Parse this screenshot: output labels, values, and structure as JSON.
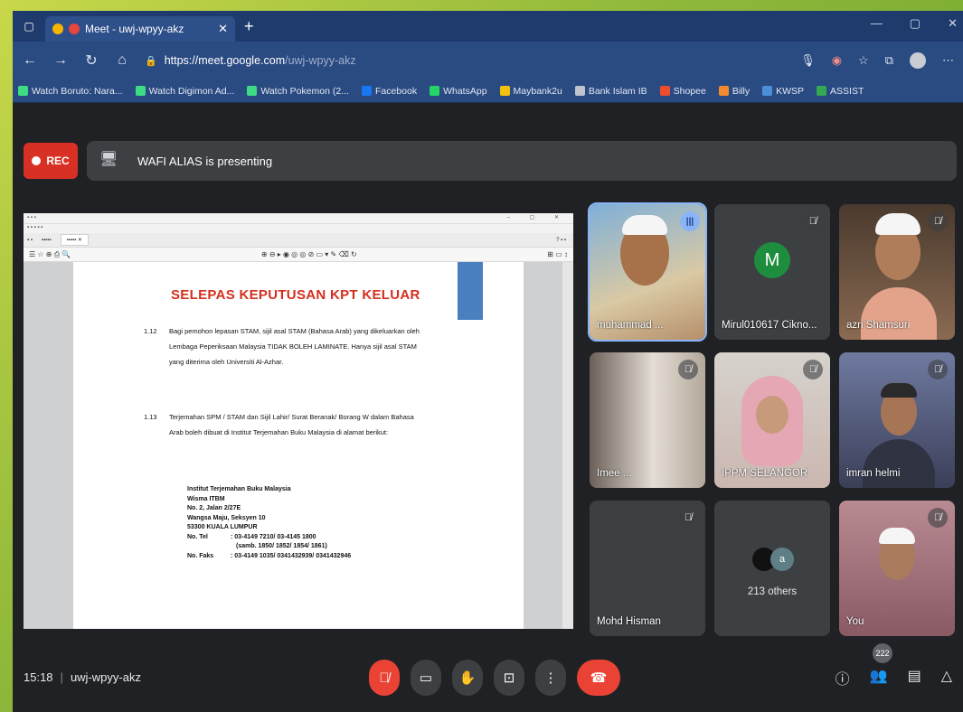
{
  "browser": {
    "tab_title": "Meet - uwj-wpyy-akz",
    "url_host": "https://meet.google.com",
    "url_path": "/uwj-wpyy-akz",
    "bookmarks": [
      {
        "label": "Watch Boruto: Nara...",
        "color": "#3ddc84"
      },
      {
        "label": "Watch Digimon Ad...",
        "color": "#3ddc84"
      },
      {
        "label": "Watch Pokemon (2...",
        "color": "#3ddc84"
      },
      {
        "label": "Facebook",
        "color": "#1877f2"
      },
      {
        "label": "WhatsApp",
        "color": "#25d366"
      },
      {
        "label": "Maybank2u",
        "color": "#f4c20d"
      },
      {
        "label": "Bank Islam IB",
        "color": "#c0c4cc"
      },
      {
        "label": "Shopee",
        "color": "#ee4d2d"
      },
      {
        "label": "Billy",
        "color": "#f28b30"
      },
      {
        "label": "KWSP",
        "color": "#4a90d9"
      },
      {
        "label": "ASSIST",
        "color": "#34a853"
      }
    ]
  },
  "meet": {
    "rec_label": "REC",
    "presenting_text": "WAFI ALIAS is presenting",
    "meeting_code": "uwj-wpyy-akz",
    "time": "15:18",
    "participant_count": "222",
    "others_label": "213 others",
    "others_initial": "a",
    "avatar_letter": "M",
    "tiles": [
      {
        "name": "muhammad ..."
      },
      {
        "name": "Mirul010617 Cikno..."
      },
      {
        "name": "azri Shamsuri"
      },
      {
        "name": "Imee ..."
      },
      {
        "name": "IPPM SELANGOR"
      },
      {
        "name": "imran helmi"
      },
      {
        "name": "Mohd Hisman"
      },
      {
        "name": "You"
      }
    ]
  },
  "document": {
    "title": "SELEPAS KEPUTUSAN KPT KELUAR",
    "p1_num": "1.12",
    "p1_text": "Bagi pemohon lepasan STAM, sijil asal STAM (Bahasa Arab) yang dikeluarkan oleh Lembaga Peperiksaan Malaysia TIDAK BOLEH LAMINATE. Hanya sijil asal STAM yang diterima oleh Universiti Al-Azhar.",
    "p2_num": "1.13",
    "p2_text": "Terjemahan SPM / STAM dan Sijil Lahir/ Surat Beranak/ Borang W dalam Bahasa Arab boleh dibuat di Institut Terjemahan Buku Malaysia di alamat berikut:",
    "address": [
      "Institut Terjemahan Buku Malaysia",
      "Wisma ITBM",
      "No. 2, Jalan 2/27E",
      "Wangsa Maju, Seksyen 10",
      "53300 KUALA LUMPUR"
    ],
    "tel_label": "No. Tel",
    "tel_value": ": 03-4149 7210/ 03-4145 1800",
    "tel_ext": "(samb. 1850/ 1852/ 1854/ 1861)",
    "fax_label": "No. Faks",
    "fax_value": ": 03-4149 1035/ 0341432939/ 0341432946"
  },
  "colors": {
    "rec_red": "#d93025",
    "end_call_red": "#ea4335",
    "active_speaker": "#8ab4f8",
    "doc_title_red": "#d32f1e"
  }
}
